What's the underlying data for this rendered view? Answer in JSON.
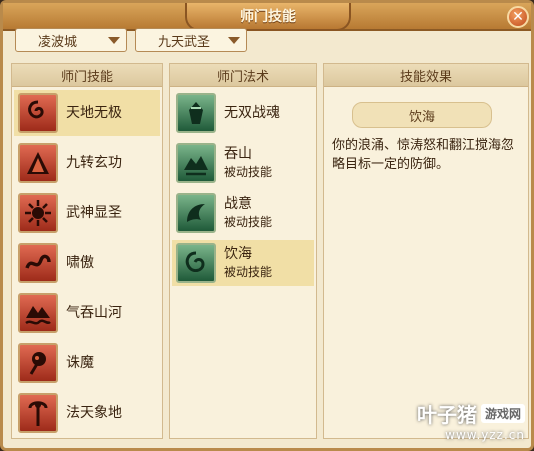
{
  "window": {
    "title": "师门技能",
    "close_glyph": "✕"
  },
  "filters": {
    "city": "凌波城",
    "school": "九天武圣"
  },
  "panels": {
    "skills": {
      "header": "师门技能",
      "items": [
        {
          "label": "天地无极",
          "icon": "swirl-icon"
        },
        {
          "label": "九转玄功",
          "icon": "pyramid-icon"
        },
        {
          "label": "武神显圣",
          "icon": "sun-burst-icon"
        },
        {
          "label": "啸傲",
          "icon": "dragon-icon"
        },
        {
          "label": "气吞山河",
          "icon": "mountain-wave-icon"
        },
        {
          "label": "诛魔",
          "icon": "demon-icon"
        },
        {
          "label": "法天象地",
          "icon": "staff-icon"
        }
      ]
    },
    "spells": {
      "header": "师门法术",
      "items": [
        {
          "label": "无双战魂",
          "sub": "",
          "icon": "warrior-spirit-icon"
        },
        {
          "label": "吞山",
          "sub": "被动技能",
          "icon": "swallow-mountain-icon"
        },
        {
          "label": "战意",
          "sub": "被动技能",
          "icon": "battle-will-icon"
        },
        {
          "label": "饮海",
          "sub": "被动技能",
          "icon": "drink-sea-icon"
        }
      ]
    },
    "effect": {
      "header": "技能效果",
      "title": "饮海",
      "description": "你的浪涌、惊涛怒和翻江搅海忽略目标一定的防御。"
    }
  },
  "watermark": {
    "main": "叶子猪",
    "badge": "游戏网",
    "url": "www.yzz.cn"
  }
}
